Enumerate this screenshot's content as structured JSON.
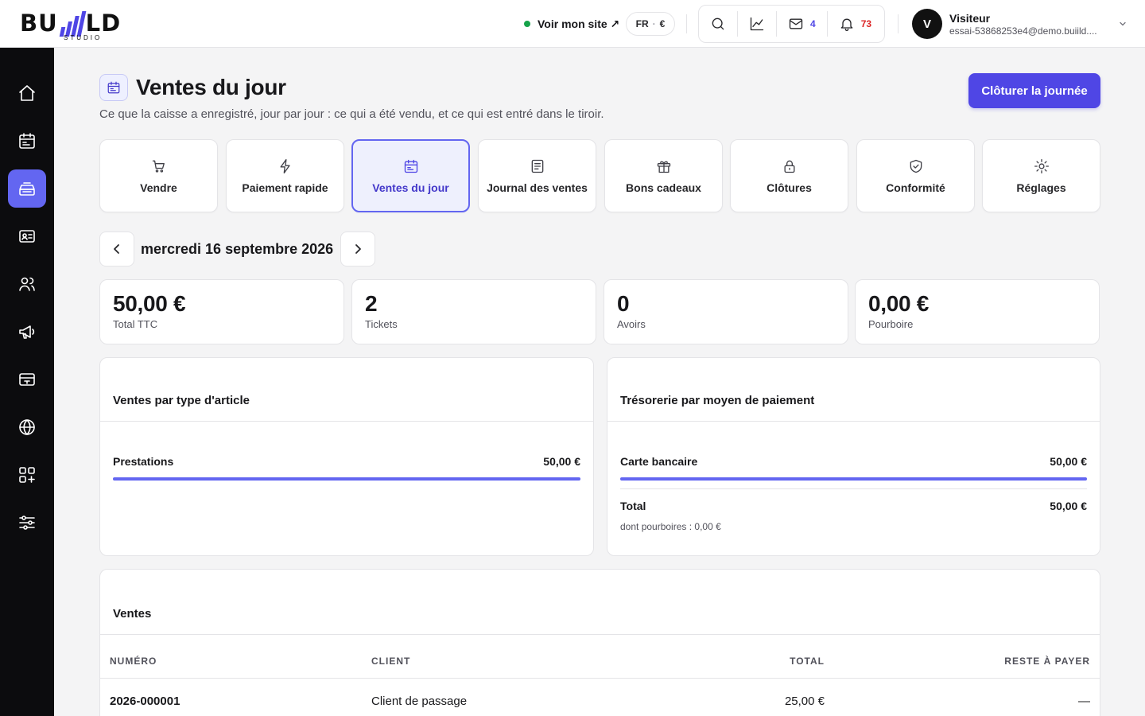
{
  "brand": {
    "word_left": "BU",
    "word_right": "LD",
    "sub": "STUDIO"
  },
  "header": {
    "site_link": "Voir mon site ↗",
    "lang": "FR",
    "currency": "€",
    "mail_count": "4",
    "notif_count": "73",
    "user_initial": "V",
    "user_name": "Visiteur",
    "user_email": "essai-53868253e4@demo.buiild...."
  },
  "page": {
    "title": "Ventes du jour",
    "subtitle": "Ce que la caisse a enregistré, jour par jour : ce qui a été vendu, et ce qui est entré dans le tiroir.",
    "close_button": "Clôturer la journée"
  },
  "tabs": [
    {
      "label": "Vendre",
      "icon": "cart-icon"
    },
    {
      "label": "Paiement rapide",
      "icon": "bolt-icon"
    },
    {
      "label": "Ventes du jour",
      "icon": "calendar-icon",
      "active": true
    },
    {
      "label": "Journal des ventes",
      "icon": "document-icon"
    },
    {
      "label": "Bons cadeaux",
      "icon": "gift-icon"
    },
    {
      "label": "Clôtures",
      "icon": "lock-icon"
    },
    {
      "label": "Conformité",
      "icon": "shield-check-icon"
    },
    {
      "label": "Réglages",
      "icon": "sun-gear-icon"
    }
  ],
  "date": {
    "label": "mercredi 16 septembre 2026"
  },
  "stats": [
    {
      "value": "50,00 €",
      "caption": "Total TTC"
    },
    {
      "value": "2",
      "caption": "Tickets"
    },
    {
      "value": "0",
      "caption": "Avoirs"
    },
    {
      "value": "0,00 €",
      "caption": "Pourboire"
    }
  ],
  "sales_by_type": {
    "title": "Ventes par type d'article",
    "rows": [
      {
        "label": "Prestations",
        "amount": "50,00 €",
        "share": 1.0
      }
    ]
  },
  "treasury": {
    "title": "Trésorerie par moyen de paiement",
    "rows": [
      {
        "label": "Carte bancaire",
        "amount": "50,00 €",
        "share": 1.0
      }
    ],
    "total_label": "Total",
    "total_amount": "50,00 €",
    "tips_note": "dont pourboires : 0,00 €"
  },
  "sales_table": {
    "title": "Ventes",
    "columns": [
      "NUMÉRO",
      "CLIENT",
      "TOTAL",
      "RESTE À PAYER"
    ],
    "rows": [
      [
        "2026-000001",
        "Client de passage",
        "25,00 €",
        "—"
      ]
    ]
  },
  "colors": {
    "accent": "#4f46e5",
    "accent_soft": "#6366f1",
    "sidebar": "#0c0c0e",
    "online": "#16a34a",
    "alert": "#dc2626"
  }
}
